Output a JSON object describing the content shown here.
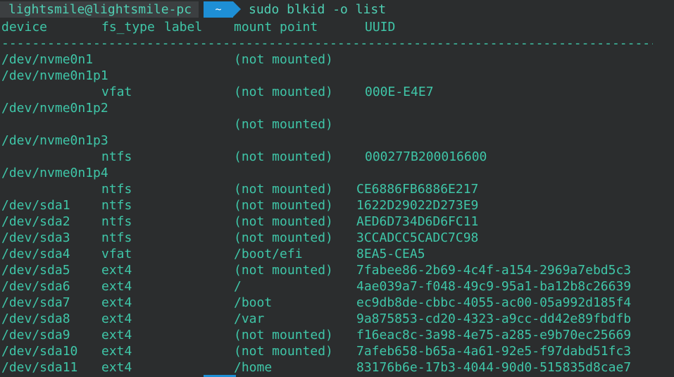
{
  "prompt": {
    "user_host": "lightsmile@lightsmile-pc",
    "directory": "~",
    "command": "sudo blkid -o list"
  },
  "headers": {
    "device": "device",
    "fs_type": "fs_type",
    "label": "label",
    "mount_point": "mount point",
    "uuid": "UUID"
  },
  "separator": "-----------------------------------------------------------------------------------------------------------",
  "rows": [
    {
      "device": "/dev/nvme0n1",
      "fs_type": "",
      "mount": "(not mounted)",
      "uuid": ""
    },
    {
      "device": "/dev/nvme0n1p1",
      "fs_type": "",
      "mount": "",
      "uuid": ""
    },
    {
      "device": "",
      "fs_type": "vfat",
      "mount": "(not mounted)",
      "uuid": "000E-E4E7"
    },
    {
      "device": "/dev/nvme0n1p2",
      "fs_type": "",
      "mount": "",
      "uuid": ""
    },
    {
      "device": "",
      "fs_type": "",
      "mount": "(not mounted)",
      "uuid": ""
    },
    {
      "device": "/dev/nvme0n1p3",
      "fs_type": "",
      "mount": "",
      "uuid": ""
    },
    {
      "device": "",
      "fs_type": "ntfs",
      "mount": "(not mounted)",
      "uuid": "000277B200016600"
    },
    {
      "device": "/dev/nvme0n1p4",
      "fs_type": "",
      "mount": "",
      "uuid": ""
    },
    {
      "device": "",
      "fs_type": "ntfs",
      "mount": "(not mounted)",
      "uuid": "CE6886FB6886E217"
    },
    {
      "device": "/dev/sda1",
      "fs_type": "ntfs",
      "mount": "(not mounted)",
      "uuid": "1622D29022D273E9"
    },
    {
      "device": "/dev/sda2",
      "fs_type": "ntfs",
      "mount": "(not mounted)",
      "uuid": "AED6D734D6D6FC11"
    },
    {
      "device": "/dev/sda3",
      "fs_type": "ntfs",
      "mount": "(not mounted)",
      "uuid": "3CCADCC5CADC7C98"
    },
    {
      "device": "/dev/sda4",
      "fs_type": "vfat",
      "mount": "/boot/efi",
      "uuid": "8EA5-CEA5"
    },
    {
      "device": "/dev/sda5",
      "fs_type": "ext4",
      "mount": "(not mounted)",
      "uuid": "7fabee86-2b69-4c4f-a154-2969a7ebd5c3"
    },
    {
      "device": "/dev/sda6",
      "fs_type": "ext4",
      "mount": "/",
      "uuid": "4ae039a7-f048-49c9-95a1-ba12b8c26639"
    },
    {
      "device": "/dev/sda7",
      "fs_type": "ext4",
      "mount": "/boot",
      "uuid": "ec9db8de-cbbc-4055-ac00-05a992d185f4"
    },
    {
      "device": "/dev/sda8",
      "fs_type": "ext4",
      "mount": "/var",
      "uuid": "9a875853-cd20-4323-a9cc-dd42e89fbdfb"
    },
    {
      "device": "/dev/sda9",
      "fs_type": "ext4",
      "mount": "(not mounted)",
      "uuid": "f16eac8c-3a98-4e75-a285-e9b70ec25669"
    },
    {
      "device": "/dev/sda10",
      "fs_type": "ext4",
      "mount": "(not mounted)",
      "uuid": "7afeb658-b65a-4a61-92e5-f97dabd51fc3"
    },
    {
      "device": "/dev/sda11",
      "fs_type": "ext4",
      "mount": "/home",
      "uuid": "83176b6e-17b3-4044-90d0-515835d8cae7"
    }
  ],
  "colors": {
    "background": "#2b2d2e",
    "text": "#3fc6a8",
    "segment_user_bg": "#3c3f41",
    "segment_dir_bg": "#1e8fd6"
  }
}
